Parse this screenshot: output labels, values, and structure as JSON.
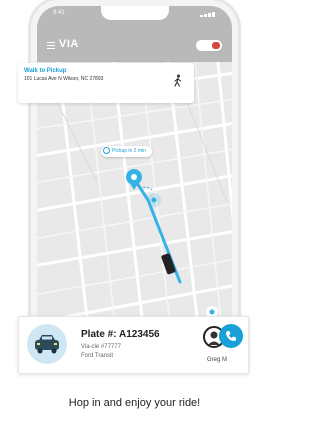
{
  "app": {
    "logo": "VIA"
  },
  "status_bar": {
    "time": "9:41"
  },
  "pickup_card": {
    "title": "Walk to Pickup",
    "address": "101 Lucas Ave N Wilson, NC 27893"
  },
  "map": {
    "pickup_chip": "Pickup in 2 min"
  },
  "ride": {
    "plate": "Plate #: A123456",
    "vehicle_id": "Via-cle #77777",
    "model": "Ford Transit",
    "driver": "Greg M"
  },
  "caption": "Hop in and enjoy your ride!",
  "colors": {
    "accent": "#1aa0d8",
    "route": "#36b3e6",
    "map_bg": "#e9e9e9"
  }
}
